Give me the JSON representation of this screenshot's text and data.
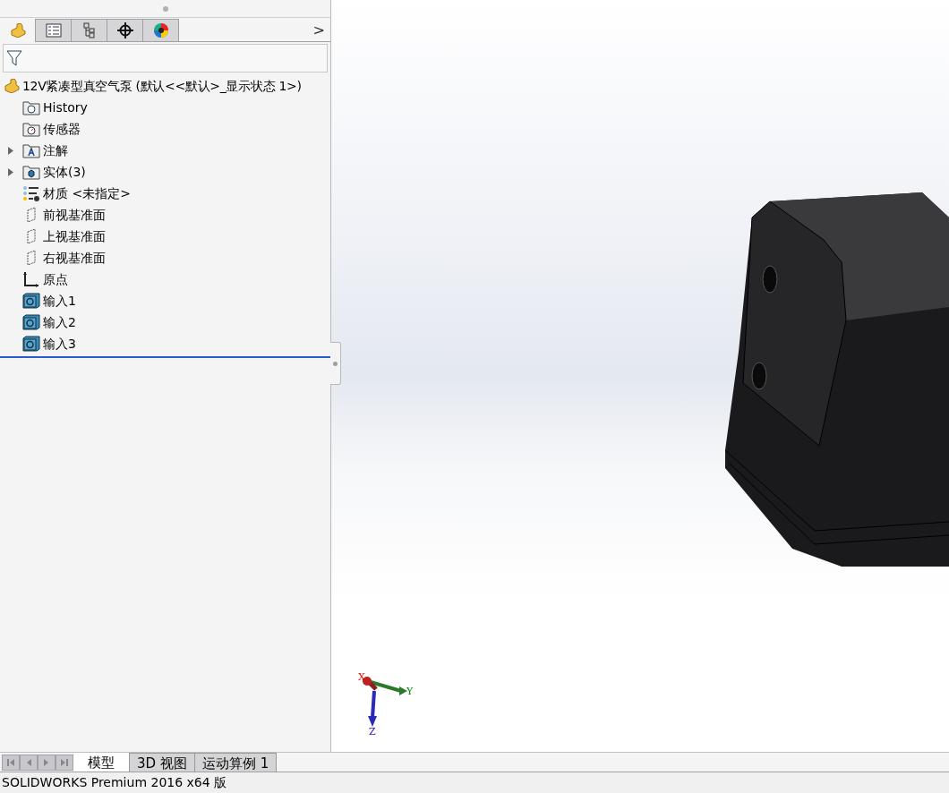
{
  "manager_tabs": [
    {
      "kind": "feature",
      "selected": true
    },
    {
      "kind": "property",
      "selected": false
    },
    {
      "kind": "config",
      "selected": false
    },
    {
      "kind": "dimxpert",
      "selected": false
    },
    {
      "kind": "display",
      "selected": false
    }
  ],
  "more_tabs": ">",
  "tree": {
    "root": "12V紧凑型真空气泵  (默认<<默认>_显示状态 1>)",
    "items": [
      {
        "kind": "history",
        "label": "History",
        "expandable": false
      },
      {
        "kind": "sensor",
        "label": "传感器",
        "expandable": false
      },
      {
        "kind": "annotation",
        "label": "注解",
        "expandable": true
      },
      {
        "kind": "solid",
        "label": "实体(3)",
        "expandable": true
      },
      {
        "kind": "material",
        "label": "材质 <未指定>",
        "expandable": false
      },
      {
        "kind": "plane",
        "label": "前视基准面",
        "expandable": false
      },
      {
        "kind": "plane",
        "label": "上视基准面",
        "expandable": false
      },
      {
        "kind": "plane",
        "label": "右视基准面",
        "expandable": false
      },
      {
        "kind": "origin",
        "label": "原点",
        "expandable": false
      },
      {
        "kind": "import",
        "label": "输入1",
        "expandable": false
      },
      {
        "kind": "import",
        "label": "输入2",
        "expandable": false
      },
      {
        "kind": "import",
        "label": "输入3",
        "expandable": false
      }
    ]
  },
  "triad": {
    "x": "X",
    "y": "Y",
    "z": "Z"
  },
  "bottom_tabs": [
    {
      "label": "模型",
      "selected": true
    },
    {
      "label": "3D 视图",
      "selected": false
    },
    {
      "label": "运动算例 1",
      "selected": false
    }
  ],
  "status_bar": "SOLIDWORKS Premium 2016 x64 版"
}
